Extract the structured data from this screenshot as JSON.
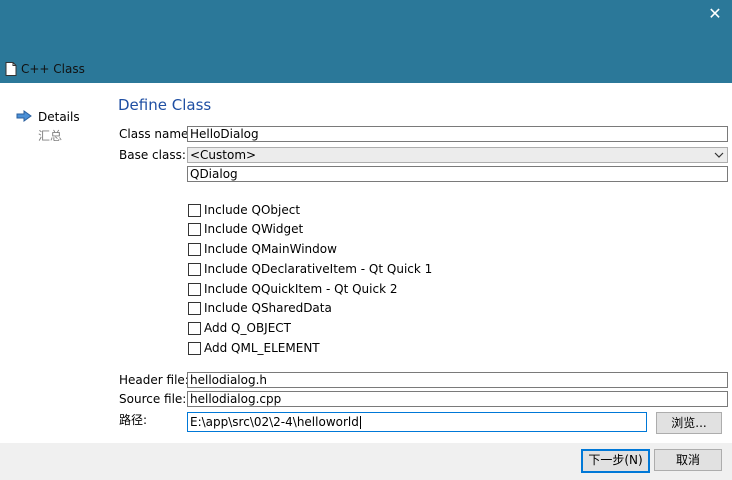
{
  "window": {
    "title": "C++ Class",
    "close_glyph": "✕"
  },
  "sidebar": {
    "steps": [
      {
        "label": "Details",
        "active": true
      },
      {
        "label": "汇总",
        "active": false
      }
    ]
  },
  "page": {
    "section_title": "Define Class"
  },
  "form": {
    "class_name_label": "Class name:",
    "class_name_value": "HelloDialog",
    "base_class_label": "Base class:",
    "base_class_value": "<Custom>",
    "custom_base_value": "QDialog",
    "header_file_label": "Header file:",
    "header_file_value": "hellodialog.h",
    "source_file_label": "Source file:",
    "source_file_value": "hellodialog.cpp",
    "path_label": "路径:",
    "path_value": "E:\\app\\src\\02\\2-4\\helloworld",
    "browse_label": "浏览..."
  },
  "options": [
    {
      "label": "Include QObject",
      "checked": false
    },
    {
      "label": "Include QWidget",
      "checked": false
    },
    {
      "label": "Include QMainWindow",
      "checked": false
    },
    {
      "label": "Include QDeclarativeItem - Qt Quick 1",
      "checked": false
    },
    {
      "label": "Include QQuickItem - Qt Quick 2",
      "checked": false
    },
    {
      "label": "Include QSharedData",
      "checked": false
    },
    {
      "label": "Add Q_OBJECT",
      "checked": false
    },
    {
      "label": "Add QML_ELEMENT",
      "checked": false
    }
  ],
  "footer": {
    "next_label": "下一步(N)",
    "cancel_label": "取消"
  },
  "colors": {
    "titlebar": "#2b7899",
    "accent": "#0078d7",
    "section_title": "#1f4fa3"
  },
  "icons": {
    "close": "close-icon",
    "title": "document-icon",
    "step_arrow": "arrow-right-icon",
    "combo": "chevron-down-icon"
  }
}
